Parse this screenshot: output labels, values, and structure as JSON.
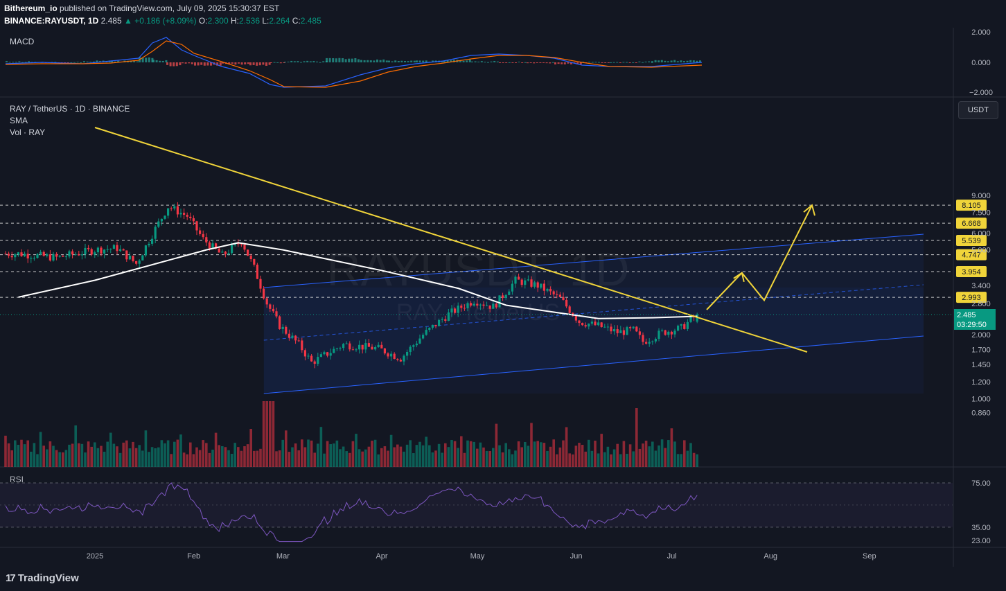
{
  "header": {
    "publisher": "Bithereum_io",
    "published_text": "published on TradingView.com, July 09, 2025 15:30:37 EST",
    "symbol_line": "BINANCE:RAYUSDT, 1D",
    "last": "2.485",
    "change": "▲ +0.186 (+8.09%)",
    "o_label": "O:",
    "o": "2.300",
    "h_label": "H:",
    "h": "2.536",
    "l_label": "L:",
    "l": "2.264",
    "c_label": "C:",
    "c": "2.485"
  },
  "panes": {
    "macd_title": "MACD",
    "price_title": "RAY / TetherUS · 1D · BINANCE",
    "sma_title": "SMA",
    "vol_title": "Vol · RAY",
    "rsi_title": "RSI"
  },
  "currency_button": "USDT",
  "watermark": {
    "line1": "RAYUSDT, 1D",
    "line2": "RAY / TetherUS"
  },
  "branding": "TradingView",
  "colors": {
    "background": "#131722",
    "bull": "#089981",
    "bear": "#f23645",
    "trendline": "#f0d43a",
    "channel": "#2962ff",
    "sma": "#ffffff",
    "macd": "#2962ff",
    "signal": "#ff6d00",
    "rsi": "#7e57c2"
  },
  "chart_data": {
    "type": "candlestick",
    "x_ticks": [
      "2025",
      "Feb",
      "Mar",
      "Apr",
      "May",
      "Jun",
      "Jul",
      "Aug",
      "Sep"
    ],
    "y_ticks": [
      "9.000",
      "7.500",
      "6.000",
      "5.000",
      "3.400",
      "2.800",
      "2.000",
      "1.700",
      "1.450",
      "1.200",
      "1.000",
      "0.860"
    ],
    "log_scale": true,
    "resistance_levels": [
      "8.105",
      "6.668",
      "5.539",
      "4.747",
      "3.954",
      "2.993"
    ],
    "last_price": "2.485",
    "countdown": "03:29:50",
    "close_path": [
      [
        "2024-12-08",
        4.8
      ],
      [
        "2024-12-20",
        4.6
      ],
      [
        "2025-01-01",
        5.0
      ],
      [
        "2025-01-08",
        5.1
      ],
      [
        "2025-01-14",
        4.3
      ],
      [
        "2025-01-20",
        6.3
      ],
      [
        "2025-01-24",
        8.0
      ],
      [
        "2025-01-30",
        7.2
      ],
      [
        "2025-02-04",
        5.6
      ],
      [
        "2025-02-10",
        4.7
      ],
      [
        "2025-02-16",
        5.5
      ],
      [
        "2025-02-20",
        4.1
      ],
      [
        "2025-02-24",
        2.8
      ],
      [
        "2025-02-28",
        2.2
      ],
      [
        "2025-03-06",
        1.8
      ],
      [
        "2025-03-10",
        1.48
      ],
      [
        "2025-03-20",
        1.8
      ],
      [
        "2025-03-31",
        1.72
      ],
      [
        "2025-04-07",
        1.55
      ],
      [
        "2025-04-14",
        2.0
      ],
      [
        "2025-04-22",
        2.5
      ],
      [
        "2025-04-30",
        2.9
      ],
      [
        "2025-05-06",
        2.7
      ],
      [
        "2025-05-13",
        3.6
      ],
      [
        "2025-05-20",
        3.4
      ],
      [
        "2025-05-27",
        2.95
      ],
      [
        "2025-06-02",
        2.3
      ],
      [
        "2025-06-08",
        2.2
      ],
      [
        "2025-06-14",
        2.05
      ],
      [
        "2025-06-19",
        2.1
      ],
      [
        "2025-06-22",
        1.85
      ],
      [
        "2025-06-28",
        2.05
      ],
      [
        "2025-07-04",
        2.15
      ],
      [
        "2025-07-09",
        2.485
      ]
    ],
    "sma_path": [
      [
        "2024-12-08",
        3.0
      ],
      [
        "2025-01-01",
        3.6
      ],
      [
        "2025-01-20",
        4.3
      ],
      [
        "2025-02-05",
        5.0
      ],
      [
        "2025-02-15",
        5.4
      ],
      [
        "2025-03-01",
        5.0
      ],
      [
        "2025-04-01",
        4.0
      ],
      [
        "2025-04-25",
        3.3
      ],
      [
        "2025-05-10",
        2.75
      ],
      [
        "2025-05-25",
        2.55
      ],
      [
        "2025-06-08",
        2.38
      ],
      [
        "2025-06-25",
        2.4
      ],
      [
        "2025-07-09",
        2.44
      ]
    ],
    "projection": [
      [
        "2025-07-09",
        2.6
      ],
      [
        "2025-07-23",
        3.9
      ],
      [
        "2025-07-30",
        2.9
      ],
      [
        "2025-08-14",
        8.105
      ]
    ],
    "rsi_levels": [
      "75.00",
      "35.00",
      "23.00"
    ],
    "macd_levels": [
      "2.000",
      "0.000",
      "−2.000"
    ]
  }
}
